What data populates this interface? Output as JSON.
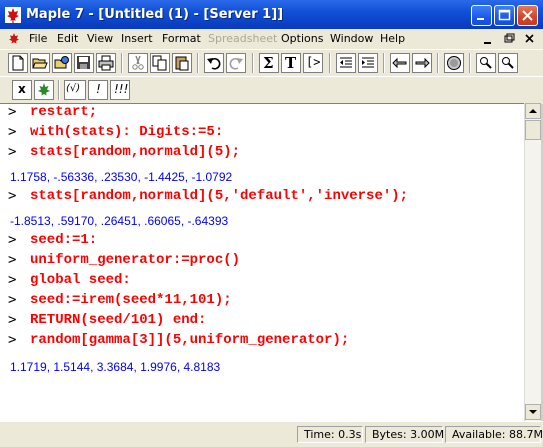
{
  "window": {
    "title": "Maple 7 - [Untitled (1) - [Server 1]]"
  },
  "menu": {
    "items": [
      {
        "label": "File",
        "disabled": false
      },
      {
        "label": "Edit",
        "disabled": false
      },
      {
        "label": "View",
        "disabled": false
      },
      {
        "label": "Insert",
        "disabled": false
      },
      {
        "label": "Format",
        "disabled": false
      },
      {
        "label": "Spreadsheet",
        "disabled": true
      },
      {
        "label": "Options",
        "disabled": false
      },
      {
        "label": "Window",
        "disabled": false
      },
      {
        "label": "Help",
        "disabled": false
      }
    ]
  },
  "toolbar1": {
    "icons": [
      "new-document-icon",
      "open-icon",
      "open-url-icon",
      "save-icon",
      "print-icon",
      "cut-icon",
      "copy-icon",
      "paste-icon",
      "undo-icon",
      "redo-icon",
      "sigma-icon",
      "text-icon",
      "execution-group-icon",
      "outdent-icon",
      "indent-icon",
      "back-icon",
      "forward-icon",
      "stop-icon",
      "zoom-in-icon",
      "zoom-out-icon"
    ],
    "sigma_glyph": "Σ",
    "text_glyph": "T",
    "group_glyph": "[>"
  },
  "toolbar2": {
    "x_label": "x",
    "paren_label": "(√)",
    "exclaim_label": "!",
    "triple_label": "!!!"
  },
  "worksheet": {
    "lines": [
      {
        "type": "input",
        "prompt": ">",
        "text": "restart;"
      },
      {
        "type": "input",
        "prompt": ">",
        "text": "with(stats): Digits:=5:"
      },
      {
        "type": "input",
        "prompt": ">",
        "text": "stats[random,normald](5);"
      },
      {
        "type": "output",
        "text": "1.1758, -.56336, .23530, -1.4425, -1.0792"
      },
      {
        "type": "input",
        "prompt": ">",
        "text": "stats[random,normald](5,'default','inverse');"
      },
      {
        "type": "output",
        "text": "-1.8513, .59170, .26451, .66065, -.64393"
      },
      {
        "type": "input",
        "prompt": ">",
        "text": "seed:=1:"
      },
      {
        "type": "input",
        "prompt": ">",
        "text": "uniform_generator:=proc()"
      },
      {
        "type": "input",
        "prompt": ">",
        "text": "global seed:"
      },
      {
        "type": "input",
        "prompt": ">",
        "text": "seed:=irem(seed*11,101);"
      },
      {
        "type": "input",
        "prompt": ">",
        "text": "RETURN(seed/101) end:"
      },
      {
        "type": "input",
        "prompt": ">",
        "text": "random[gamma[3]](5,uniform_generator);"
      },
      {
        "type": "output",
        "text": "1.1719, 1.5144, 3.3684, 1.9976, 4.8183"
      }
    ]
  },
  "status": {
    "time": "Time:  0.3s",
    "bytes": "Bytes: 3.00M",
    "available": "Available: 88.7M"
  },
  "colors": {
    "input_text": "#ff0000",
    "output_text": "#0000ff",
    "titlebar": "#0a3fc4"
  }
}
